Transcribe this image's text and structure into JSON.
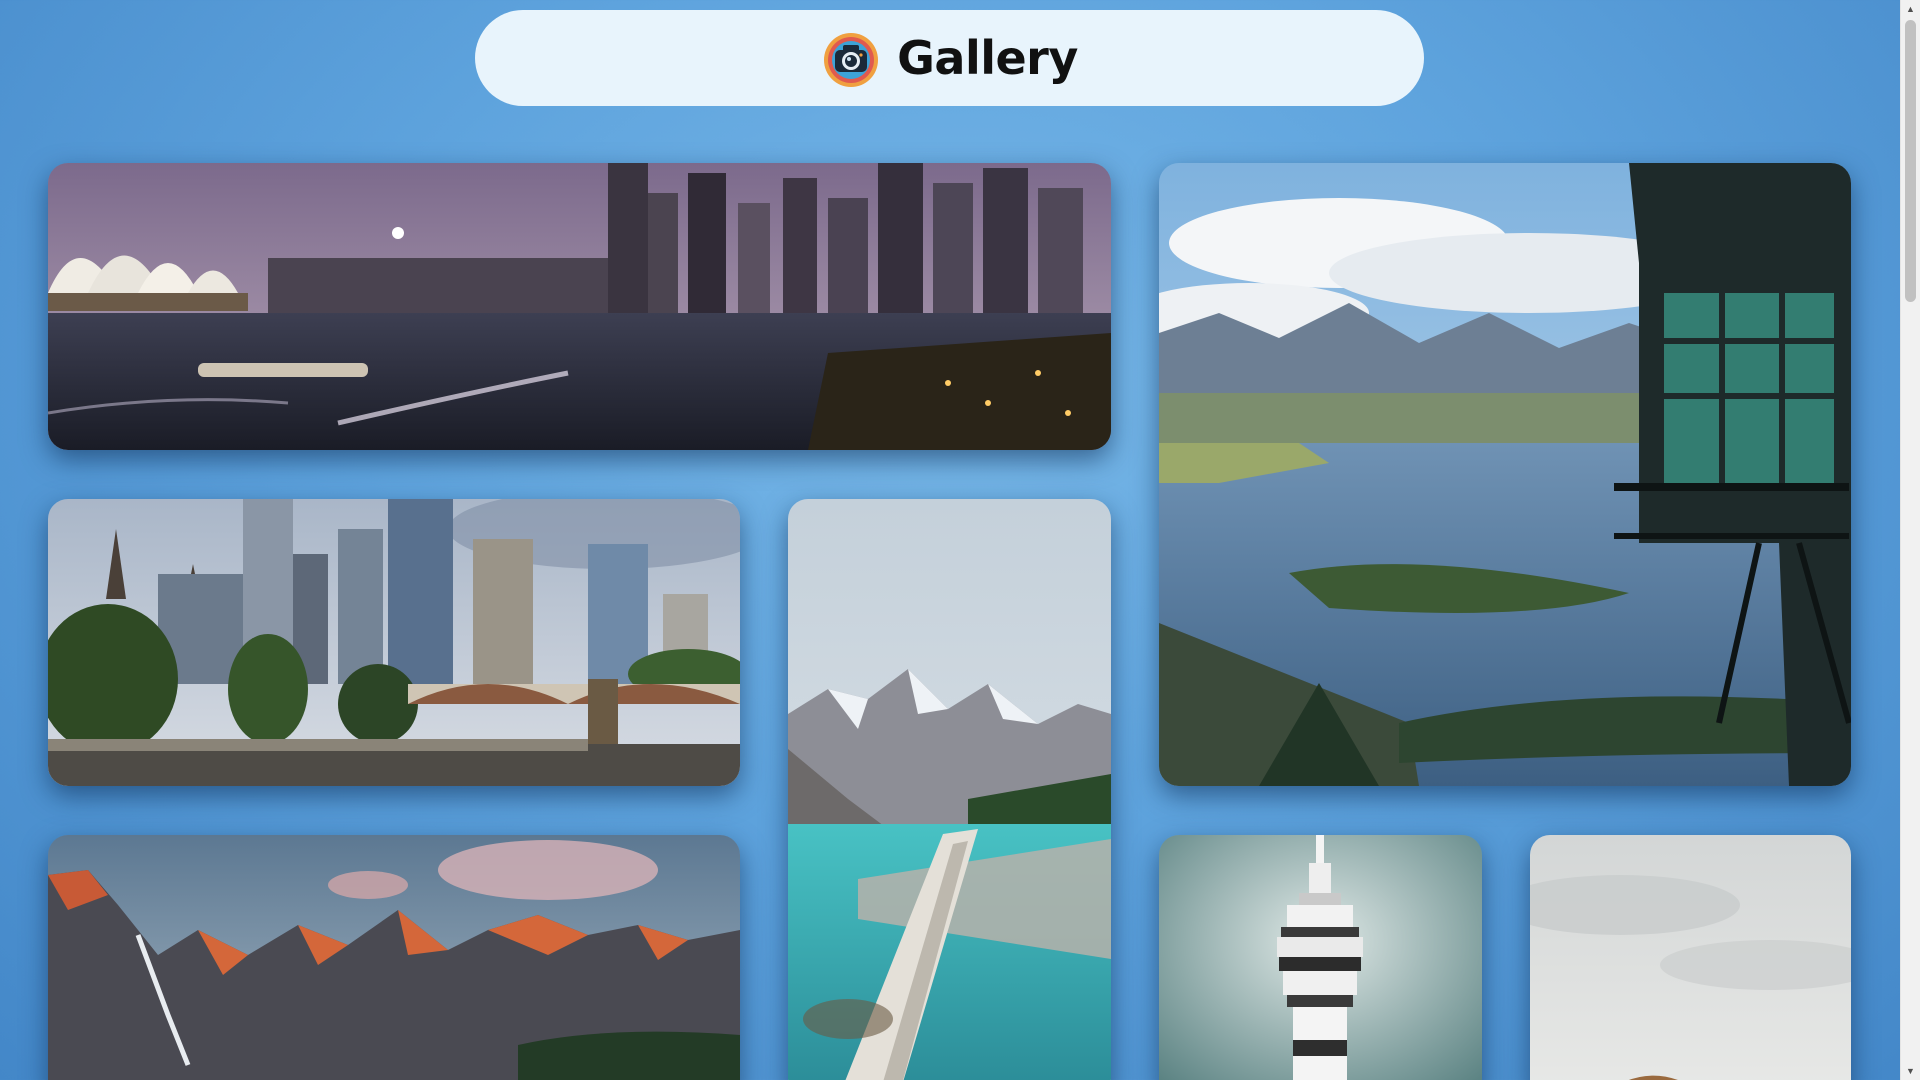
{
  "header": {
    "title": "Gallery",
    "logo_icon": "camera-lens-icon"
  },
  "gallery": {
    "photos": [
      {
        "subject": "sydney-harbour-night-skyline"
      },
      {
        "subject": "queenstown-lake-mountains-lookout"
      },
      {
        "subject": "melbourne-city-bridge-river"
      },
      {
        "subject": "moraine-lake-turquoise-log"
      },
      {
        "subject": "rocky-mountain-peaks-sunset"
      },
      {
        "subject": "auckland-sky-tower"
      },
      {
        "subject": "cloudy-sky-hot-air-balloon"
      }
    ]
  },
  "colors": {
    "background": "#5ea3dd",
    "header_background": "#e8f4fc",
    "title_text": "#111111"
  }
}
